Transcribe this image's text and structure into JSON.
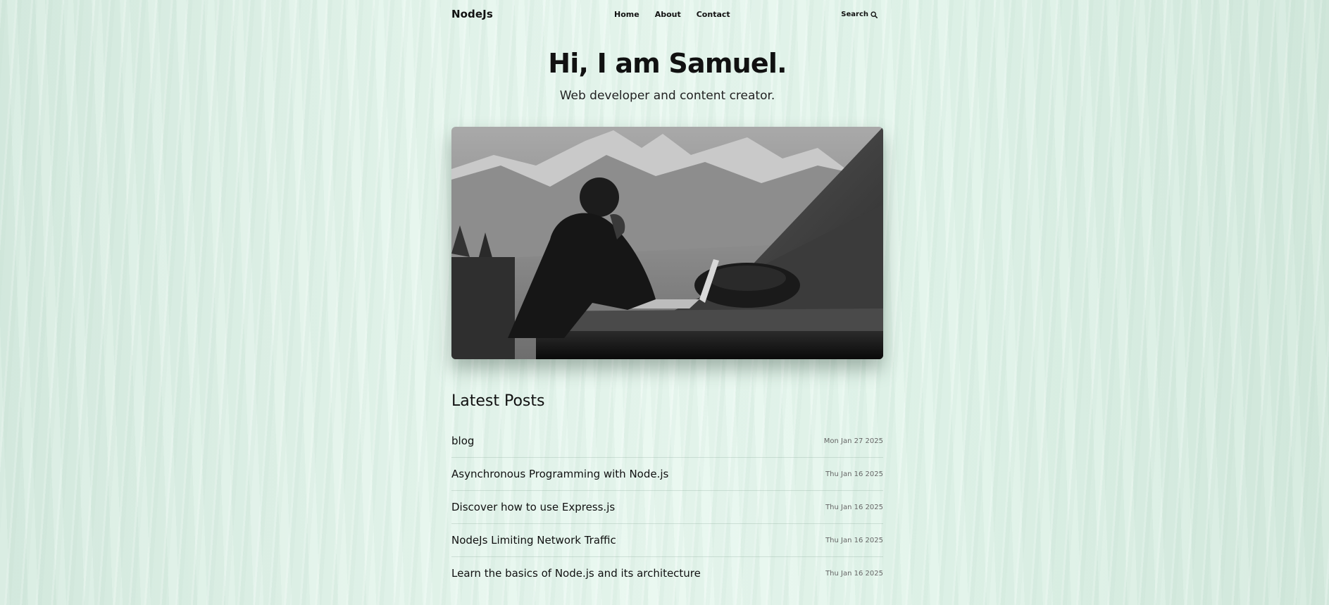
{
  "header": {
    "logo": "NodeJs",
    "nav": [
      "Home",
      "About",
      "Contact"
    ],
    "search_label": "Search"
  },
  "hero": {
    "title": "Hi, I am Samuel.",
    "subtitle": "Web developer and content creator."
  },
  "posts": {
    "heading": "Latest Posts",
    "items": [
      {
        "title": "blog",
        "date": "Mon Jan 27 2025"
      },
      {
        "title": "Asynchronous Programming with Node.js",
        "date": "Thu Jan 16 2025"
      },
      {
        "title": "Discover how to use Express.js",
        "date": "Thu Jan 16 2025"
      },
      {
        "title": "NodeJs Limiting Network Traffic",
        "date": "Thu Jan 16 2025"
      },
      {
        "title": "Learn the basics of Node.js and its architecture",
        "date": "Thu Jan 16 2025"
      }
    ]
  },
  "colors": {
    "background": "#e1f3ea",
    "text": "#111111",
    "date": "#666666"
  },
  "icons": {
    "search": "search-icon"
  }
}
